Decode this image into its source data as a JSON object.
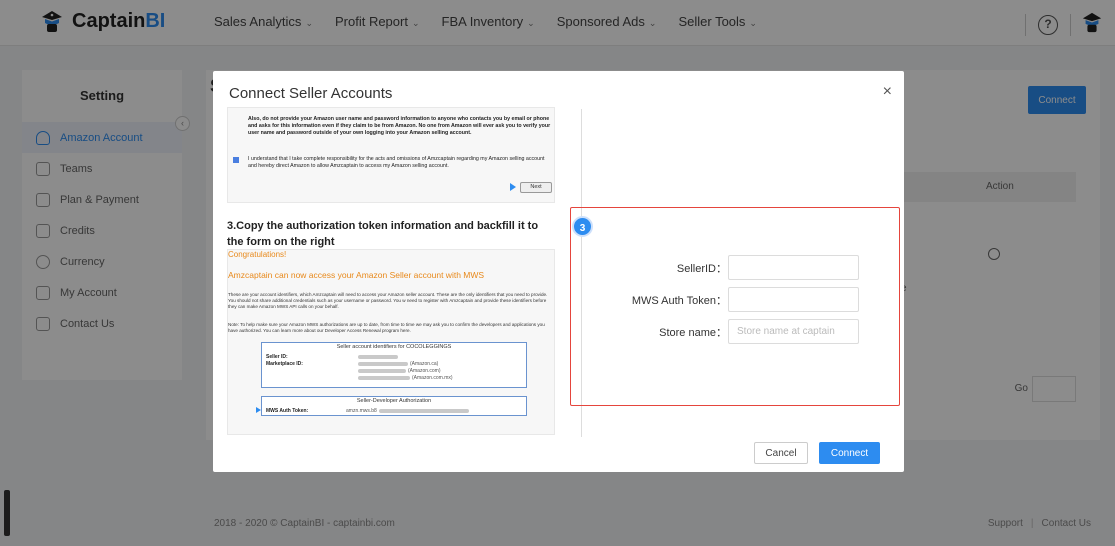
{
  "brand": {
    "name_main": "Captain",
    "name_accent": "BI"
  },
  "nav": [
    {
      "label": "Sales Analytics"
    },
    {
      "label": "Profit Report"
    },
    {
      "label": "FBA Inventory"
    },
    {
      "label": "Sponsored Ads"
    },
    {
      "label": "Seller Tools"
    }
  ],
  "header": {
    "help_glyph": "?"
  },
  "sidebar": {
    "title": "Setting",
    "items": [
      {
        "label": "Amazon Account",
        "icon": "user-icon",
        "active": true
      },
      {
        "label": "Teams",
        "icon": "team-icon"
      },
      {
        "label": "Plan & Payment",
        "icon": "plan-icon"
      },
      {
        "label": "Credits",
        "icon": "credits-icon"
      },
      {
        "label": "Currency",
        "icon": "currency-icon"
      },
      {
        "label": "My Account",
        "icon": "account-icon"
      },
      {
        "label": "Contact Us",
        "icon": "phone-icon"
      }
    ]
  },
  "main": {
    "title_initial": "S",
    "connect_label": "Connect",
    "table_action_header": "Action",
    "row_site_fragment": "ite",
    "go_label": "Go"
  },
  "footer": {
    "copyright": "2018 - 2020 © CaptainBI - captainbi.com",
    "support": "Support",
    "contact": "Contact Us"
  },
  "modal": {
    "title": "Connect Seller Accounts",
    "close_glyph": "×",
    "guide_step1": {
      "warning": "Also, do not provide your Amazon user name and password information to anyone who contacts you by email or phone and asks for this information even if they claim to be from Amazon. No one from Amazon will ever ask you to verify your user name and password outside of your own logging into your Amazon selling account.",
      "agree": "I understand that I take complete responsibility for the acts and omissions of Amzcaptain regarding my Amazon selling account and hereby direct Amazon to allow Amzcaptain to access my Amazon selling account.",
      "next_label": "Next"
    },
    "step3_title": "3.Copy the authorization token information and backfill it to the form on the right",
    "guide_step3": {
      "congrats": "Congratulations!",
      "access": "Amzcaptain can now access your Amazon Seller account with MWS",
      "para1": "These are your account identifiers, which Amzcaptain will need to access your Amazon seller account. These are the only identifiers that you need to provide. You should not share additional credentials such as your username or password. You w need to register with Amzcaptain and provide these identifiers before they can make Amazon MWS API calls on your behalf.",
      "para2": "Note: To help make sure your Amazon MWS authorizations are up to date, from time to time we may ask you to confirm the developers and applications you have authorized. You can learn more about our Developer Access Renewal program here.",
      "box1_header": "Seller account identifiers for COCOLEGGINGS",
      "seller_id_label": "Seller ID:",
      "marketplace_label": "Marketplace ID:",
      "market_ca": "(Amazon.ca)",
      "market_com": "(Amazon.com)",
      "market_mx": "(Amazon.com.mx)",
      "box2_header": "Seller-Developer Authorization",
      "mws_label": "MWS Auth Token:",
      "mws_value": "amzn.mws.b8"
    },
    "step_badge": "3",
    "form": {
      "seller_id_label": "SellerID：",
      "seller_id_value": "",
      "mws_token_label": "MWS Auth Token：",
      "mws_token_value": "",
      "store_name_label": "Store name：",
      "store_name_placeholder": "Store name at captain"
    },
    "cancel_label": "Cancel",
    "connect_label": "Connect"
  },
  "colors": {
    "accent": "#2d8cf0",
    "highlight": "#e5453d",
    "orange_text": "#e8891b"
  }
}
